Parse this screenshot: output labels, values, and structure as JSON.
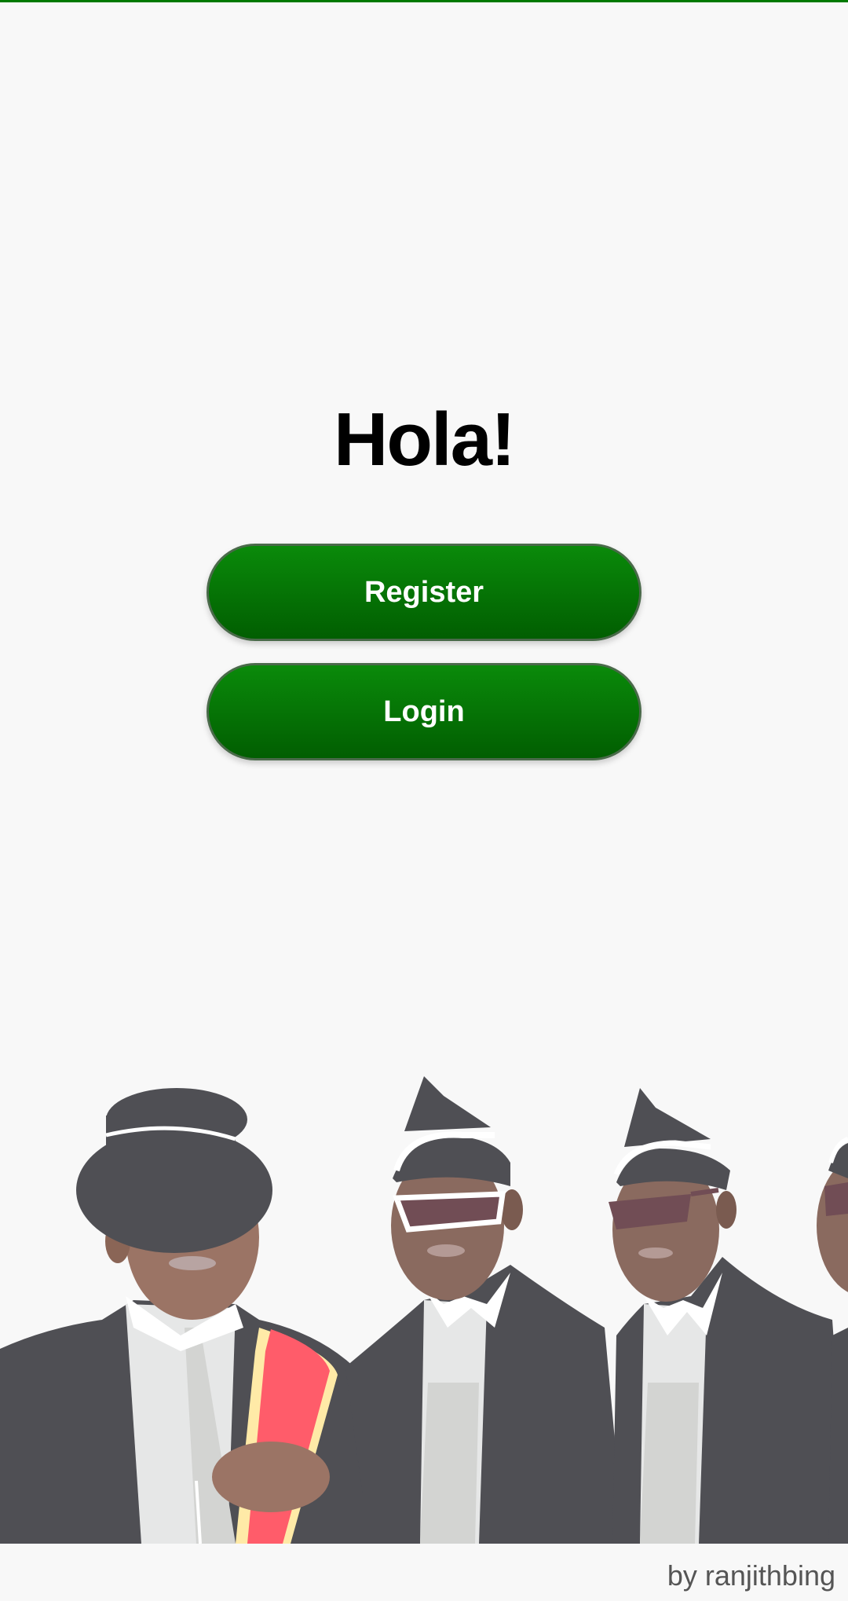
{
  "theme": {
    "accent": "#007a00",
    "button_top": "#0a8a0a",
    "button_bottom": "#015e01",
    "background": "#f8f8f8"
  },
  "welcome": {
    "title": "Hola!"
  },
  "actions": {
    "register_label": "Register",
    "login_label": "Login"
  },
  "illustration": {
    "icon": "coffin-dance-pallbearers-illustration"
  },
  "footer": {
    "credit": "by ranjithbing"
  }
}
